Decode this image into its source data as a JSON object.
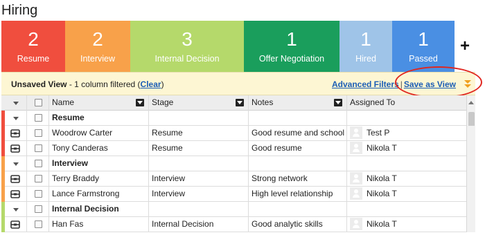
{
  "page": {
    "title": "Hiring"
  },
  "stages": [
    {
      "count": "2",
      "label": "Resume",
      "color": "#f04e3e"
    },
    {
      "count": "2",
      "label": "Interview",
      "color": "#f8a14a"
    },
    {
      "count": "3",
      "label": "Internal Decision",
      "color": "#b5d96b"
    },
    {
      "count": "1",
      "label": "Offer Negotiation",
      "color": "#1a9e5c"
    },
    {
      "count": "1",
      "label": "Hired",
      "color": "#9fc4e8"
    },
    {
      "count": "1",
      "label": "Passed",
      "color": "#4a8fe3"
    }
  ],
  "add_stage_label": "+",
  "filterbar": {
    "view_name": "Unsaved View",
    "status": " - 1 column filtered (",
    "clear_label": "Clear",
    "close_paren": ")",
    "advanced_filters_label": "Advanced Filters",
    "separator": "|",
    "save_view_label": "Save as View",
    "collapse_icon": "double-chevron-down-icon"
  },
  "columns": {
    "name": "Name",
    "stage": "Stage",
    "notes": "Notes",
    "assigned": "Assigned To"
  },
  "groups": [
    {
      "label": "Resume",
      "color": "#f04e3e",
      "rows": [
        {
          "name": "Woodrow Carter",
          "stage": "Resume",
          "notes": "Good resume and school (C",
          "assigned": "Test P"
        },
        {
          "name": "Tony Canderas",
          "stage": "Resume",
          "notes": "Good resume",
          "assigned": "Nikola T"
        }
      ]
    },
    {
      "label": "Interview",
      "color": "#f8a14a",
      "rows": [
        {
          "name": "Terry Braddy",
          "stage": "Interview",
          "notes": "Strong network",
          "assigned": "Nikola T"
        },
        {
          "name": "Lance Farmstrong",
          "stage": "Interview",
          "notes": "High level relationship",
          "assigned": "Nikola T"
        }
      ]
    },
    {
      "label": "Internal Decision",
      "color": "#b5d96b",
      "rows": [
        {
          "name": "Han Fas",
          "stage": "Internal Decision",
          "notes": "Good analytic skills",
          "assigned": "Nikola T"
        }
      ]
    }
  ]
}
